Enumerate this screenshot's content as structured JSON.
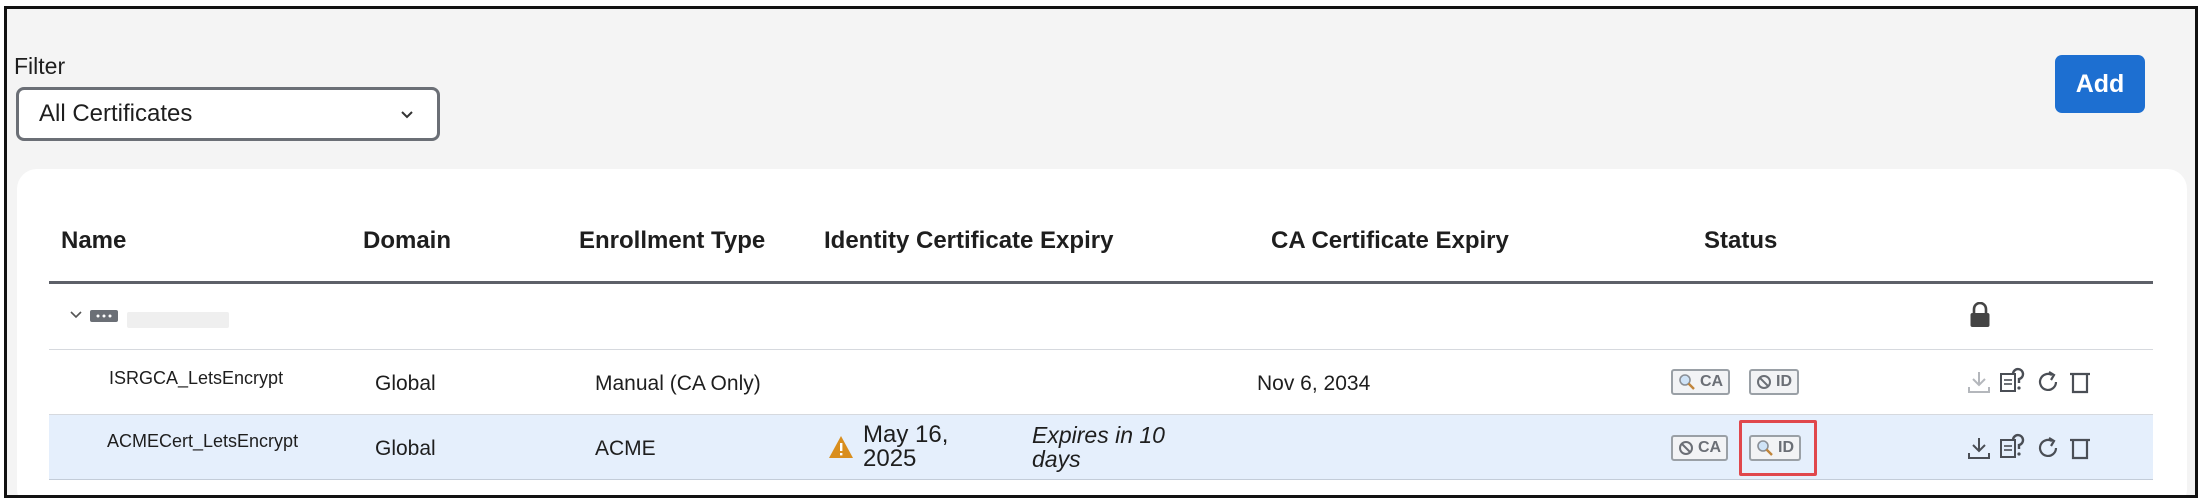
{
  "filter": {
    "label": "Filter",
    "selected": "All Certificates"
  },
  "add_button": {
    "label": "Add"
  },
  "table": {
    "columns": [
      "Name",
      "Domain",
      "Enrollment Type",
      "Identity Certificate Expiry",
      "CA Certificate Expiry",
      "Status"
    ],
    "group": {
      "device_name": ""
    },
    "rows": [
      {
        "name": "ISRGCA_LetsEncrypt",
        "domain": "Global",
        "enrollment": "Manual (CA Only)",
        "id_expiry": "",
        "id_expiry_note": "",
        "ca_expiry": "Nov 6, 2034",
        "status": [
          {
            "icon": "magnifier-icon",
            "label": "CA"
          },
          {
            "icon": "blocked-icon",
            "label": "ID"
          }
        ]
      },
      {
        "name": "ACMECert_LetsEncrypt",
        "domain": "Global",
        "enrollment": "ACME",
        "id_expiry": "May 16, 2025",
        "id_expiry_line1": "May 16,",
        "id_expiry_line2": "2025",
        "id_expiry_note_line1": "Expires in 10",
        "id_expiry_note_line2": "days",
        "ca_expiry": "",
        "status": [
          {
            "icon": "blocked-icon",
            "label": "CA"
          },
          {
            "icon": "magnifier-icon",
            "label": "ID"
          }
        ],
        "selected": true
      }
    ]
  },
  "colors": {
    "accent": "#1d6fd1",
    "selected_row": "#e5effc",
    "warning": "#d98e1e",
    "highlight": "#e0474c"
  }
}
